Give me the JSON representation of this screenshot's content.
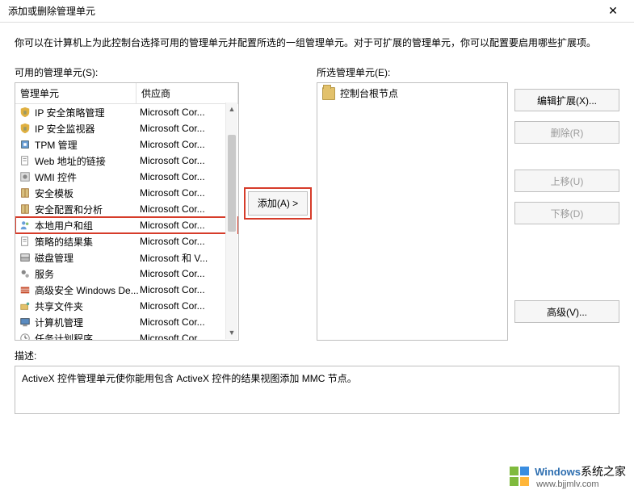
{
  "window": {
    "title": "添加或删除管理单元",
    "close_glyph": "✕"
  },
  "intro": "你可以在计算机上为此控制台选择可用的管理单元并配置所选的一组管理单元。对于可扩展的管理单元，你可以配置要启用哪些扩展项。",
  "labels": {
    "available": "可用的管理单元(S):",
    "selected": "所选管理单元(E):",
    "col_snapin": "管理单元",
    "col_vendor": "供应商",
    "description_label": "描述:"
  },
  "buttons": {
    "add": "添加(A) >",
    "edit_ext": "编辑扩展(X)...",
    "remove": "删除(R)",
    "move_up": "上移(U)",
    "move_down": "下移(D)",
    "advanced": "高级(V)..."
  },
  "selected_root": "控制台根节点",
  "snapins": [
    {
      "name": "IP 安全策略管理",
      "vendor": "Microsoft Cor...",
      "icon": "shield-key",
      "hl": false
    },
    {
      "name": "IP 安全监视器",
      "vendor": "Microsoft Cor...",
      "icon": "shield-key",
      "hl": false
    },
    {
      "name": "TPM 管理",
      "vendor": "Microsoft Cor...",
      "icon": "chip",
      "hl": false
    },
    {
      "name": "Web 地址的链接",
      "vendor": "Microsoft Cor...",
      "icon": "doc",
      "hl": false
    },
    {
      "name": "WMI 控件",
      "vendor": "Microsoft Cor...",
      "icon": "gear-box",
      "hl": false
    },
    {
      "name": "安全模板",
      "vendor": "Microsoft Cor...",
      "icon": "book",
      "hl": false
    },
    {
      "name": "安全配置和分析",
      "vendor": "Microsoft Cor...",
      "icon": "book",
      "hl": false
    },
    {
      "name": "本地用户和组",
      "vendor": "Microsoft Cor...",
      "icon": "users",
      "hl": true
    },
    {
      "name": "策略的结果集",
      "vendor": "Microsoft Cor...",
      "icon": "doc",
      "hl": false
    },
    {
      "name": "磁盘管理",
      "vendor": "Microsoft 和 V...",
      "icon": "disk",
      "hl": false
    },
    {
      "name": "服务",
      "vendor": "Microsoft Cor...",
      "icon": "gears",
      "hl": false
    },
    {
      "name": "高级安全 Windows De...",
      "vendor": "Microsoft Cor...",
      "icon": "firewall",
      "hl": false
    },
    {
      "name": "共享文件夹",
      "vendor": "Microsoft Cor...",
      "icon": "share",
      "hl": false
    },
    {
      "name": "计算机管理",
      "vendor": "Microsoft Cor...",
      "icon": "computer",
      "hl": false
    },
    {
      "name": "任务计划程序",
      "vendor": "Microsoft Cor...",
      "icon": "clock",
      "hl": false
    }
  ],
  "description_text": "ActiveX 控件管理单元使你能用包含 ActiveX 控件的结果视图添加 MMC 节点。",
  "watermark": {
    "brand_en": "Windows",
    "brand_cn": "系统之家",
    "url": "www.bjjmlv.com"
  }
}
